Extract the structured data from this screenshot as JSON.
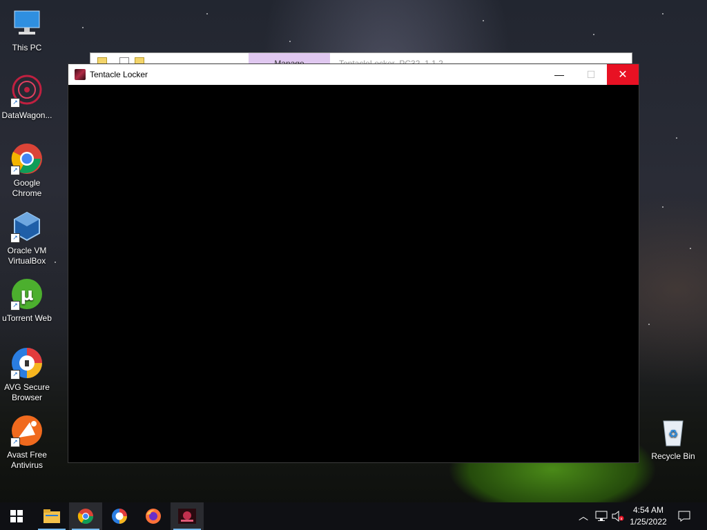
{
  "desktop": {
    "icons": [
      {
        "label": "This PC",
        "icon": "computer-icon"
      },
      {
        "label": "DataWagon...",
        "icon": "datawagon-icon"
      },
      {
        "label": "Google Chrome",
        "icon": "chrome-icon"
      },
      {
        "label": "Oracle VM VirtualBox",
        "icon": "virtualbox-icon"
      },
      {
        "label": "uTorrent Web",
        "icon": "utorrent-icon"
      },
      {
        "label": "AVG Secure Browser",
        "icon": "avg-browser-icon"
      },
      {
        "label": "Avast Free Antivirus",
        "icon": "avast-icon"
      },
      {
        "label": "Recycle Bin",
        "icon": "recycle-bin-icon"
      }
    ]
  },
  "background_window": {
    "tab_label": "Manage",
    "title": "TentacleLocker_PC32_1.1.2"
  },
  "window": {
    "title": "Tentacle Locker",
    "minimize_symbol": "—",
    "maximize_symbol": "☐",
    "close_symbol": "✕"
  },
  "taskbar": {
    "items": [
      {
        "name": "start-button",
        "icon": "windows-icon"
      },
      {
        "name": "file-explorer",
        "icon": "folder-icon"
      },
      {
        "name": "google-chrome",
        "icon": "chrome-icon"
      },
      {
        "name": "avg-secure-browser",
        "icon": "avg-browser-icon"
      },
      {
        "name": "firefox",
        "icon": "firefox-icon"
      },
      {
        "name": "tentacle-locker",
        "icon": "tentacle-locker-icon"
      }
    ],
    "time": "4:54 AM",
    "date": "1/25/2022"
  },
  "colors": {
    "close_red": "#e81123",
    "taskbar": "#0f1014",
    "accent": "#76b9ed"
  }
}
